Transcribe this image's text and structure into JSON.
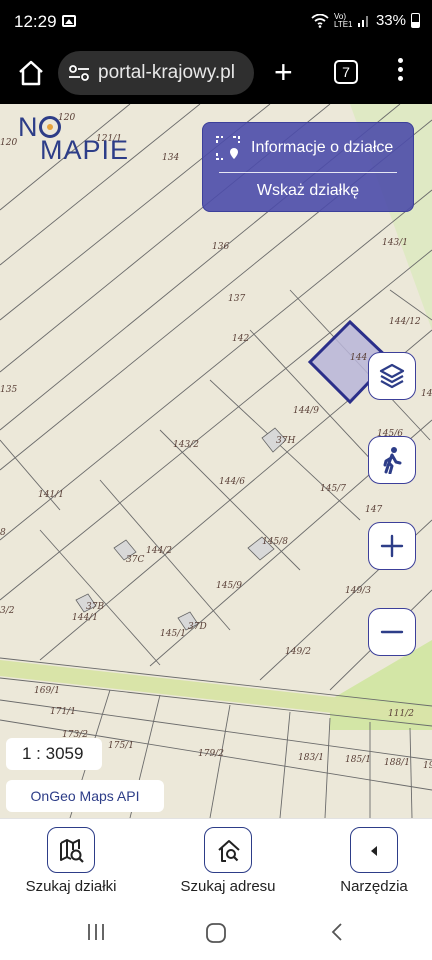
{
  "status": {
    "time": "12:29",
    "battery": "33%",
    "network": "Vo) LTE1"
  },
  "browser": {
    "url": "portal-krajowy.pl",
    "tab_count": "7"
  },
  "logo": {
    "line1": "N",
    "line1b": "",
    "line2": "MAPIE"
  },
  "info_panel": {
    "title": "Informacje o działce",
    "action": "Wskaż działkę"
  },
  "parcels": [
    "120",
    "120",
    "121/1",
    "134",
    "135",
    "136",
    "143/1",
    "137",
    "142",
    "144/12",
    "144",
    "135",
    "14",
    "144/9",
    "143/2",
    "37H",
    "145/6",
    "144/6",
    "145/7",
    "141/1",
    "147",
    "8",
    "145/8",
    "144/2",
    "37C",
    "149/3",
    "145/9",
    "3/2",
    "37B",
    "144/1",
    "37D",
    "145/1",
    "149/2",
    "169/1",
    "171/1",
    "111/2",
    "173/2",
    "175/1",
    "179/2",
    "183/1",
    "185/1",
    "188/1",
    "19",
    "175/1"
  ],
  "scale": "1 : 3059",
  "credit": "OnGeo Maps API",
  "toolbar": {
    "items": [
      {
        "label": "Szukaj działki",
        "icon": "map-search-icon"
      },
      {
        "label": "Szukaj adresu",
        "icon": "home-search-icon"
      },
      {
        "label": "Narzędzia",
        "icon": "chevron-left-icon"
      }
    ]
  },
  "colors": {
    "accent": "#2d3d88",
    "panel": "#4c4caa",
    "highlight": "#b8b5d8",
    "map_bg": "#ece8d9",
    "green": "#cfe3a4"
  }
}
